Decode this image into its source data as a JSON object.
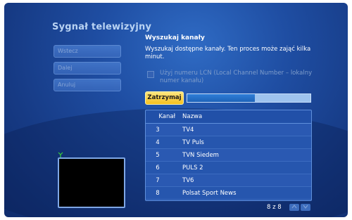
{
  "title": "Sygnał telewizyjny",
  "nav": {
    "back_label": "Wstecz",
    "next_label": "Dalej",
    "cancel_label": "Anuluj"
  },
  "section": {
    "heading": "Wyszukaj kanały",
    "description": "Wyszukaj dostępne kanały. Ten proces może zająć kilka minut.",
    "lcn_label": "Użyj numeru LCN (Local Channel Number – lokalny numer kanału)",
    "lcn_checked": false,
    "stop_label": "Zatrzymaj",
    "progress_fraction": 0.55
  },
  "table": {
    "columns": [
      "Kanał",
      "Nazwa"
    ],
    "rows": [
      {
        "number": "3",
        "name": "TV4"
      },
      {
        "number": "4",
        "name": "TV Puls"
      },
      {
        "number": "5",
        "name": "TVN Siedem"
      },
      {
        "number": "6",
        "name": "PULS 2"
      },
      {
        "number": "7",
        "name": "TV6"
      },
      {
        "number": "8",
        "name": "Polsat Sport News"
      }
    ]
  },
  "pagination": {
    "counter": "8 z 8",
    "up_icon": "chevron-up-icon",
    "down_icon": "chevron-down-icon"
  },
  "preview": {
    "signal_icon": "antenna-icon"
  },
  "colors": {
    "accent_yellow": "#f5c01e",
    "signal_green": "#38d13a",
    "background_blue": "#1f4ea3"
  }
}
